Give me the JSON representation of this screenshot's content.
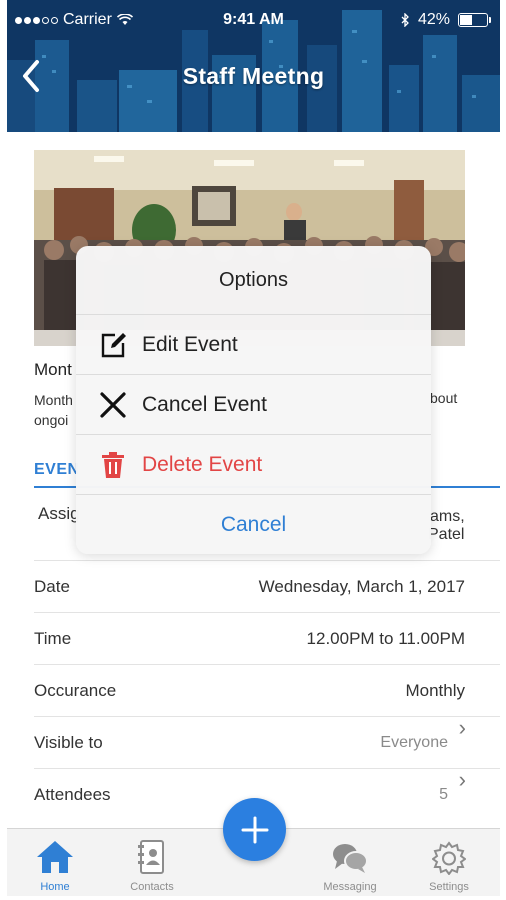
{
  "status_bar": {
    "carrier": "Carrier",
    "time": "9:41 AM",
    "battery": "42%",
    "battery_level": 0.42
  },
  "nav": {
    "title": "Staff Meetng",
    "back_icon": "chevron-left-icon"
  },
  "event": {
    "name_partial": "Mont",
    "desc_line1": "Month",
    "desc_line2": "ongoi",
    "desc_right": "bout",
    "section_tab": "EVEN"
  },
  "assigned": {
    "label": "Assig",
    "value_line1": "ams,",
    "value_line2": "Patel"
  },
  "details": [
    {
      "label": "Date",
      "value": "Wednesday, March 1, 2017"
    },
    {
      "label": "Time",
      "value": "12.00PM to 11.00PM"
    },
    {
      "label": "Occurance",
      "value": "Monthly"
    },
    {
      "label": "Visible to",
      "value": "Everyone"
    },
    {
      "label": "Attendees",
      "value": "5"
    }
  ],
  "options_sheet": {
    "title": "Options",
    "items": [
      {
        "label": "Edit Event",
        "icon": "edit-icon"
      },
      {
        "label": "Cancel Event",
        "icon": "close-icon"
      },
      {
        "label": "Delete Event",
        "icon": "trash-icon",
        "color": "#e24545"
      }
    ],
    "cancel_label": "Cancel"
  },
  "tabbar": {
    "items": [
      {
        "label": "Home",
        "icon": "home-icon",
        "active": true
      },
      {
        "label": "Contacts",
        "icon": "contacts-icon",
        "active": false
      },
      {
        "label": "Messaging",
        "icon": "messaging-icon",
        "active": false
      },
      {
        "label": "Settings",
        "icon": "gear-icon",
        "active": false
      }
    ],
    "fab_icon": "plus-icon"
  },
  "colors": {
    "accent": "#2f7fd4",
    "fab": "#2b7fe0",
    "danger": "#e24545"
  }
}
